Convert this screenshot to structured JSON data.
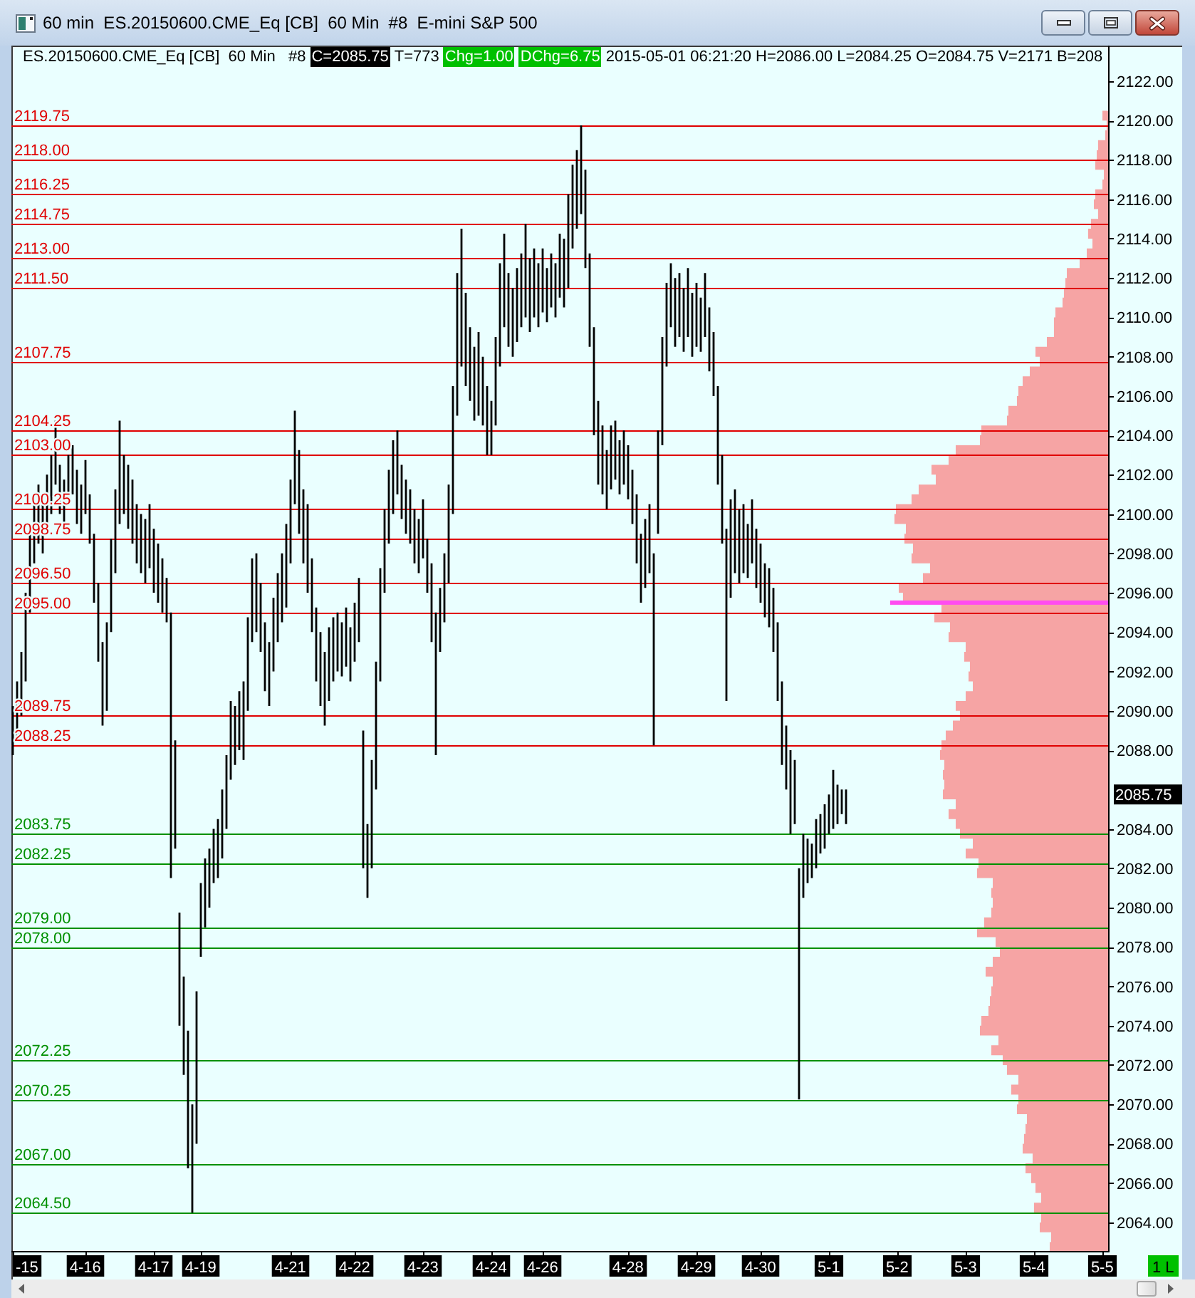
{
  "window": {
    "title": "60 min  ES.20150600.CME_Eq [CB]  60 Min  #8  E-mini S&P 500"
  },
  "info_bar": {
    "symbol": "ES.20150600.CME_Eq [CB]  60 Min   #8",
    "fields": [
      {
        "text": "C=2085.75",
        "kind": "dark"
      },
      {
        "text": "T=773",
        "kind": "plain"
      },
      {
        "text": "Chg=1.00",
        "kind": "up"
      },
      {
        "text": "DChg=6.75",
        "kind": "up"
      },
      {
        "text": "2015-05-01 06:21:20",
        "kind": "plain"
      },
      {
        "text": "H=2086.00",
        "kind": "plain"
      },
      {
        "text": "L=2084.25",
        "kind": "plain"
      },
      {
        "text": "O=2084.75",
        "kind": "plain"
      },
      {
        "text": "V=2171",
        "kind": "plain"
      },
      {
        "text": "B=208",
        "kind": "plain"
      }
    ]
  },
  "price_chart": {
    "levels": [
      {
        "label": "2119.75",
        "color": "#e00000"
      },
      {
        "label": "2118.00",
        "color": "#e00000"
      },
      {
        "label": "2116.25",
        "color": "#e00000"
      },
      {
        "label": "2114.75",
        "color": "#e00000"
      },
      {
        "label": "2113.00",
        "color": "#e00000"
      },
      {
        "label": "2111.50",
        "color": "#e00000"
      },
      {
        "label": "2107.75",
        "color": "#e00000"
      },
      {
        "label": "2104.25",
        "color": "#e00000"
      },
      {
        "label": "2103.00",
        "color": "#e00000"
      },
      {
        "label": "2100.25",
        "color": "#e00000"
      },
      {
        "label": "2098.75",
        "color": "#e00000"
      },
      {
        "label": "2096.50",
        "color": "#e00000"
      },
      {
        "label": "2095.00",
        "color": "#e00000"
      },
      {
        "label": "2089.75",
        "color": "#e00000"
      },
      {
        "label": "2088.25",
        "color": "#e00000"
      },
      {
        "label": "2083.75",
        "color": "#009000"
      },
      {
        "label": "2082.25",
        "color": "#009000"
      },
      {
        "label": "2079.00",
        "color": "#009000"
      },
      {
        "label": "2078.00",
        "color": "#009000"
      },
      {
        "label": "2072.25",
        "color": "#009000"
      },
      {
        "label": "2070.25",
        "color": "#009000"
      },
      {
        "label": "2067.00",
        "color": "#009000"
      },
      {
        "label": "2064.50",
        "color": "#009000"
      }
    ],
    "price_axis": [
      "2122.00",
      "2120.00",
      "2118.00",
      "2116.00",
      "2114.00",
      "2112.00",
      "2110.00",
      "2108.00",
      "2106.00",
      "2104.00",
      "2102.00",
      "2100.00",
      "2098.00",
      "2096.00",
      "2094.00",
      "2092.00",
      "2090.00",
      "2088.00",
      "2084.00",
      "2082.00",
      "2080.00",
      "2078.00",
      "2076.00",
      "2074.00",
      "2072.00",
      "2070.00",
      "2068.00",
      "2066.00",
      "2064.00"
    ],
    "last_price": "2085.75",
    "date_axis": [
      "-15",
      "4-16",
      "4-17",
      "4-19",
      "4-21",
      "4-22",
      "4-23",
      "4-24",
      "4-26",
      "4-28",
      "4-29",
      "4-30",
      "5-1",
      "5-2",
      "5-3",
      "5-4",
      "5-5"
    ]
  },
  "status_badge": "1 L"
}
